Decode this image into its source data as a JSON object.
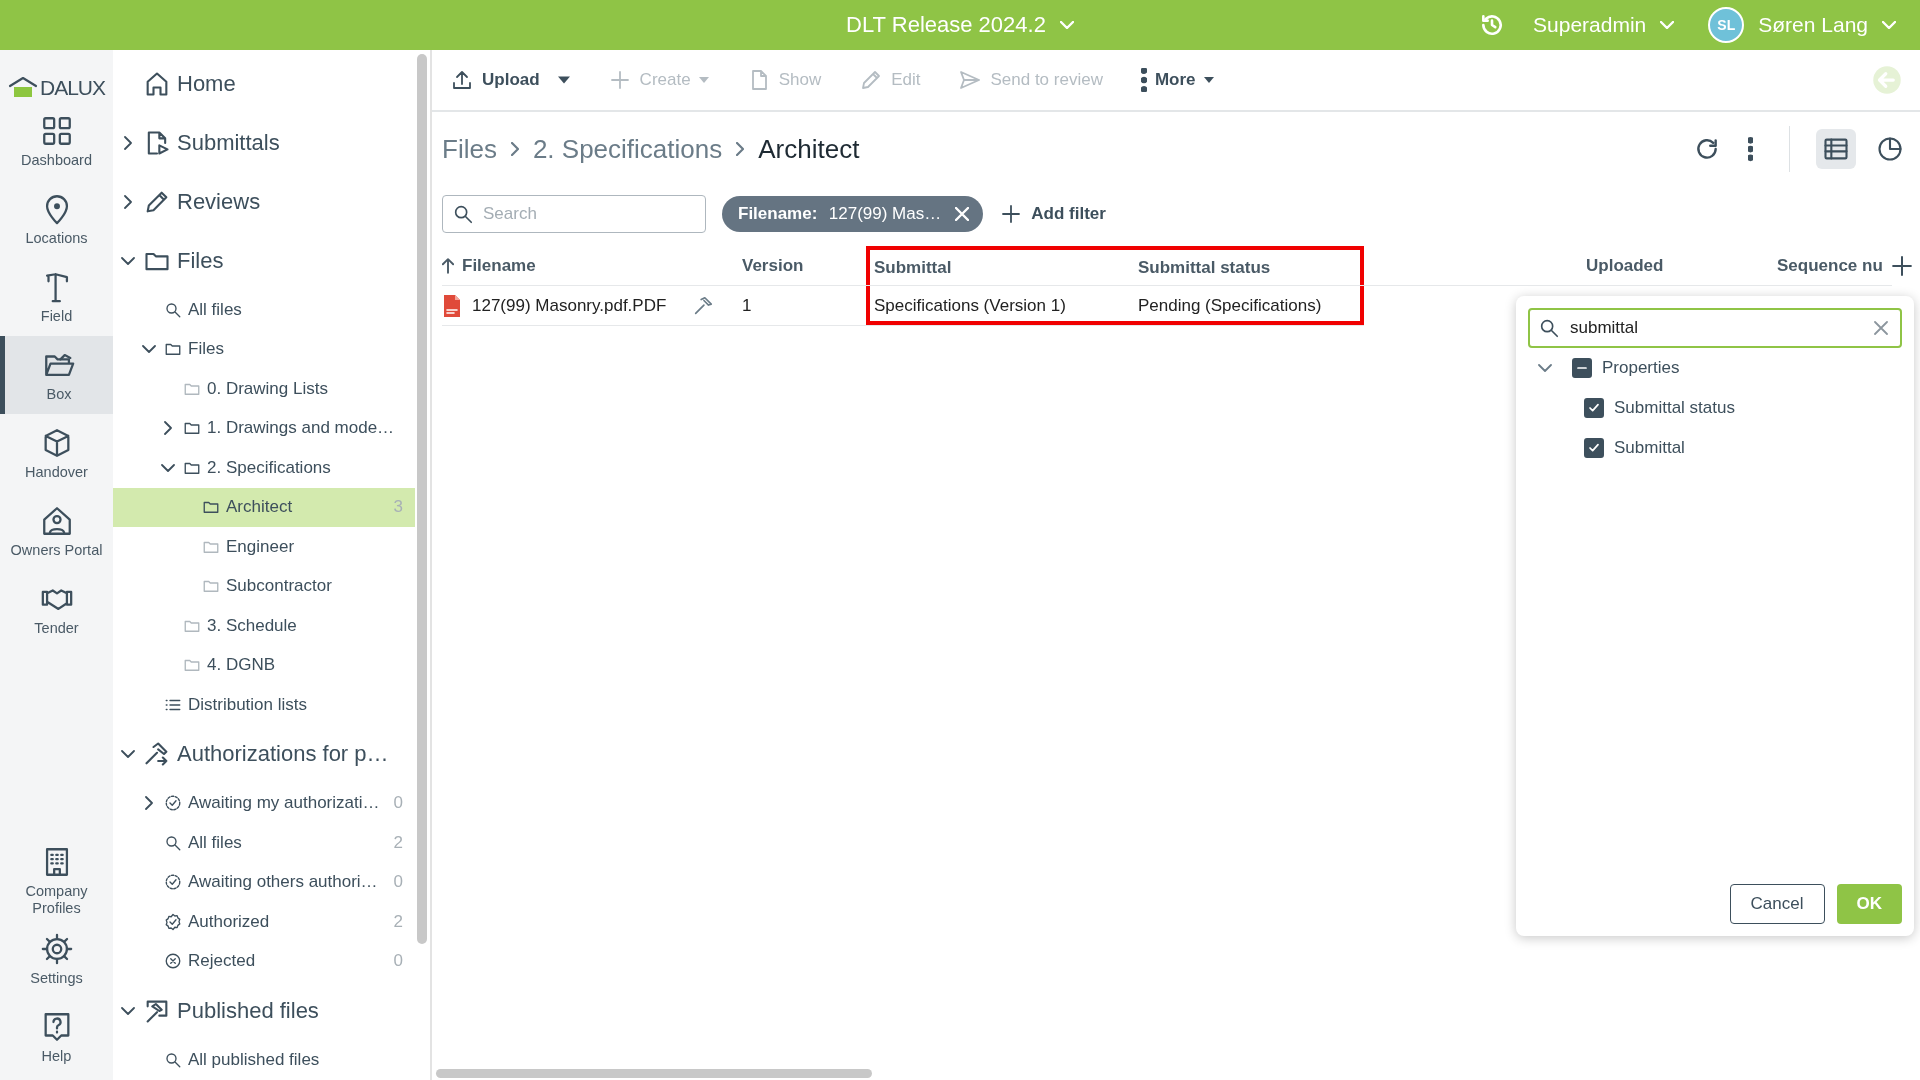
{
  "header": {
    "project": "DLT Release 2024.2",
    "role": "Superadmin",
    "user": {
      "initials": "SL",
      "name": "Søren Lang"
    }
  },
  "logo": "DALUX",
  "rail": [
    {
      "label": "Dashboard",
      "kind": "grid",
      "selected": false
    },
    {
      "label": "Locations",
      "kind": "pin",
      "selected": false
    },
    {
      "label": "Field",
      "kind": "crane",
      "selected": false
    },
    {
      "label": "Box",
      "kind": "folder-open",
      "selected": true
    },
    {
      "label": "Handover",
      "kind": "cube",
      "selected": false
    },
    {
      "label": "Owners Portal",
      "kind": "house-person",
      "selected": false
    },
    {
      "label": "Tender",
      "kind": "handshake",
      "selected": false
    }
  ],
  "rail_bottom": [
    {
      "label": "Company Profiles",
      "kind": "building",
      "selected": false
    },
    {
      "label": "Settings",
      "kind": "gear",
      "selected": false
    },
    {
      "label": "Help",
      "kind": "help",
      "selected": false
    }
  ],
  "tree": [
    {
      "label": "Home",
      "kind": "home",
      "selected": false
    },
    {
      "label": "Submittals",
      "kind": "doc-send",
      "expanded": false,
      "selected": false
    },
    {
      "label": "Reviews",
      "kind": "pencil",
      "expanded": false,
      "selected": false
    },
    {
      "label": "Files",
      "kind": "folder",
      "expanded": true,
      "selected": false,
      "children": [
        {
          "label": "All files",
          "kind": "search",
          "selected": false
        },
        {
          "label": "Files",
          "kind": "folder",
          "expanded": true,
          "selected": false,
          "children": [
            {
              "label": "0. Drawing Lists",
              "kind": "folder-empty",
              "selected": false
            },
            {
              "label": "1. Drawings and mode…",
              "kind": "folder",
              "expanded": false,
              "selected": false
            },
            {
              "label": "2. Specifications",
              "kind": "folder",
              "expanded": true,
              "selected": false,
              "children": [
                {
                  "label": "Architect",
                  "kind": "folder",
                  "selected": true,
                  "count": "3"
                },
                {
                  "label": "Engineer",
                  "kind": "folder-empty",
                  "selected": false
                },
                {
                  "label": "Subcontractor",
                  "kind": "folder-empty",
                  "selected": false
                }
              ]
            },
            {
              "label": "3. Schedule",
              "kind": "folder-empty",
              "selected": false
            },
            {
              "label": "4. DGNB",
              "kind": "folder-empty",
              "selected": false
            }
          ]
        },
        {
          "label": "Distribution lists",
          "kind": "list",
          "selected": false
        }
      ]
    },
    {
      "label": "Authorizations for p…",
      "kind": "hammer",
      "expanded": true,
      "selected": false,
      "children": [
        {
          "label": "Awaiting my authorizati…",
          "kind": "dashed-check",
          "expanded": false,
          "selected": false,
          "count": "0"
        },
        {
          "label": "All files",
          "kind": "search",
          "selected": false,
          "count": "2"
        },
        {
          "label": "Awaiting others authori…",
          "kind": "dashed-check",
          "selected": false,
          "count": "0"
        },
        {
          "label": "Authorized",
          "kind": "badge-check",
          "selected": false,
          "count": "2"
        },
        {
          "label": "Rejected",
          "kind": "x-circle",
          "selected": false,
          "count": "0"
        }
      ]
    },
    {
      "label": "Published files",
      "kind": "published",
      "expanded": true,
      "selected": false,
      "children": [
        {
          "label": "All published files",
          "kind": "search",
          "selected": false
        }
      ]
    }
  ],
  "toolbar": [
    {
      "label": "Upload",
      "kind": "upload",
      "disabled": false,
      "menu": false,
      "split_menu": true
    },
    {
      "label": "Create",
      "kind": "plus",
      "disabled": true,
      "menu": true,
      "split_menu": false
    },
    {
      "label": "Show",
      "kind": "file",
      "disabled": true,
      "menu": false,
      "split_menu": false
    },
    {
      "label": "Edit",
      "kind": "pencil",
      "disabled": true,
      "menu": false,
      "split_menu": false
    },
    {
      "label": "Send to review",
      "kind": "send",
      "disabled": true,
      "menu": false,
      "split_menu": false
    },
    {
      "label": "More",
      "kind": "kebab",
      "disabled": false,
      "menu": true,
      "split_menu": false
    }
  ],
  "breadcrumb": [
    "Files",
    "2. Specifications",
    "Architect"
  ],
  "views": [
    {
      "kind": "list-view",
      "selected": true
    },
    {
      "kind": "pie",
      "selected": false
    }
  ],
  "search": {
    "placeholder": "Search"
  },
  "filter_chip": {
    "label": "Filename:",
    "value": "127(99) Mas…"
  },
  "add_filter": "Add filter",
  "table": {
    "columns": [
      {
        "label": "Filename",
        "sorted": true,
        "highlighted": false
      },
      {
        "label": "Version",
        "sorted": false,
        "highlighted": false
      },
      {
        "label": "Submittal",
        "sorted": false,
        "highlighted": true
      },
      {
        "label": "Submittal status",
        "sorted": false,
        "highlighted": true
      },
      {
        "label": "Uploaded",
        "sorted": false,
        "highlighted": false
      },
      {
        "label": "Sequence nu",
        "sorted": false,
        "highlighted": false
      }
    ],
    "rows": [
      {
        "cells": [
          "127(99) Masonry.pdf.PDF",
          "1",
          "Specifications (Version 1)",
          "Pending (Specifications)"
        ]
      }
    ]
  },
  "column_picker": {
    "search_value": "submittal",
    "groups": [
      {
        "label": "Properties",
        "expanded": true,
        "indeterminate": true,
        "children": [
          {
            "label": "Submittal status",
            "checked": true
          },
          {
            "label": "Submittal",
            "checked": true
          }
        ]
      }
    ],
    "buttons": [
      {
        "label": "Cancel",
        "kind": "secondary"
      },
      {
        "label": "OK",
        "kind": "primary"
      }
    ]
  }
}
